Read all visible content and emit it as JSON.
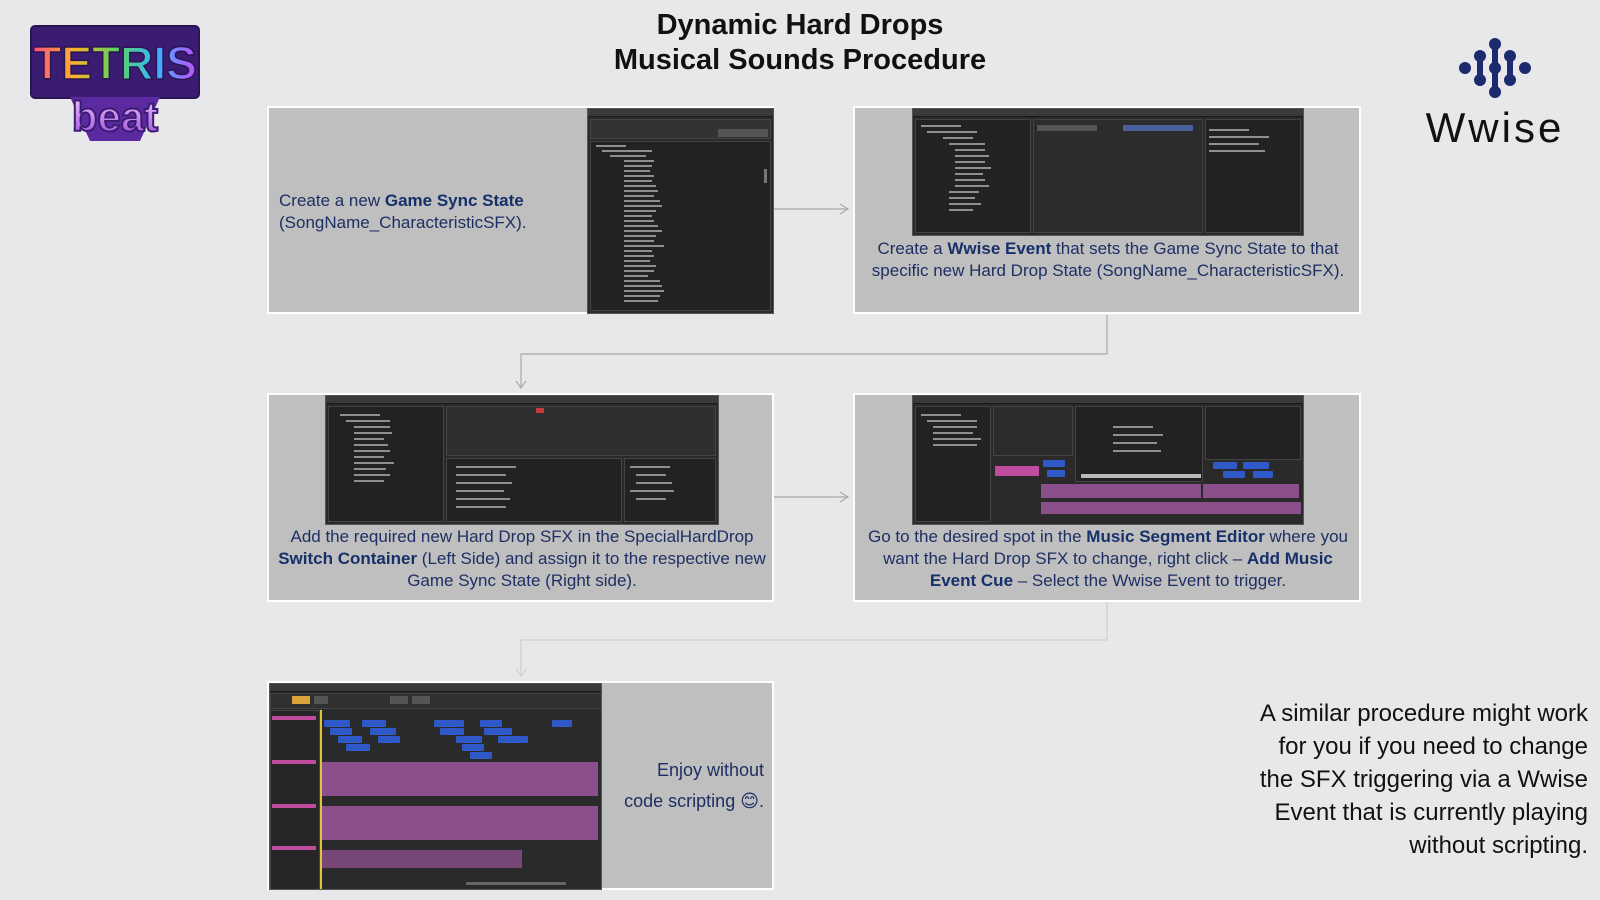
{
  "title": {
    "line1": "Dynamic Hard Drops",
    "line2": "Musical Sounds Procedure"
  },
  "logos": {
    "tetris_top": "TETRIS",
    "tetris_bottom": "beat",
    "wwise": "Wwise"
  },
  "steps": [
    {
      "pre": "Create a new ",
      "bold": "Game Sync State",
      "post": "(SongName_CharacteristicSFX)."
    },
    {
      "pre": "Create a ",
      "bold": "Wwise Event",
      "post": " that sets the Game Sync State to that specific new Hard Drop State (SongName_CharacteristicSFX)."
    },
    {
      "pre": "Add the required new Hard Drop SFX in the SpecialHardDrop ",
      "bold": "Switch Container",
      "post": " (Left Side) and assign it to the respective new Game Sync State (Right side)."
    },
    {
      "pre": "Go to the desired spot in the ",
      "bold": "Music Segment Editor",
      "mid": " where you want the Hard Drop SFX to change, right click – ",
      "bold2": "Add Music Event Cue",
      "post": " – Select the Wwise Event to trigger."
    },
    {
      "line1": "Enjoy without",
      "line2": "code scripting",
      "emoji": "😊",
      "end": "."
    }
  ],
  "side_note": "A similar procedure might work for you if you need to change the SFX triggering via a Wwise Event that is currently playing without scripting.",
  "colors": {
    "background": "#e8e7ea",
    "panel": "#bfbfbf",
    "panel_text": "#1e2f63",
    "connector": "#a9a9a9",
    "cue_chip": "#2f58c9",
    "waveform": "#8b4f8c",
    "wwise_logo": "#1c2a6e"
  },
  "icons": [
    "tetris-beat-logo",
    "wwise-logo",
    "smile-emoji-icon",
    "arrow-right-icon",
    "arrow-down-icon"
  ]
}
